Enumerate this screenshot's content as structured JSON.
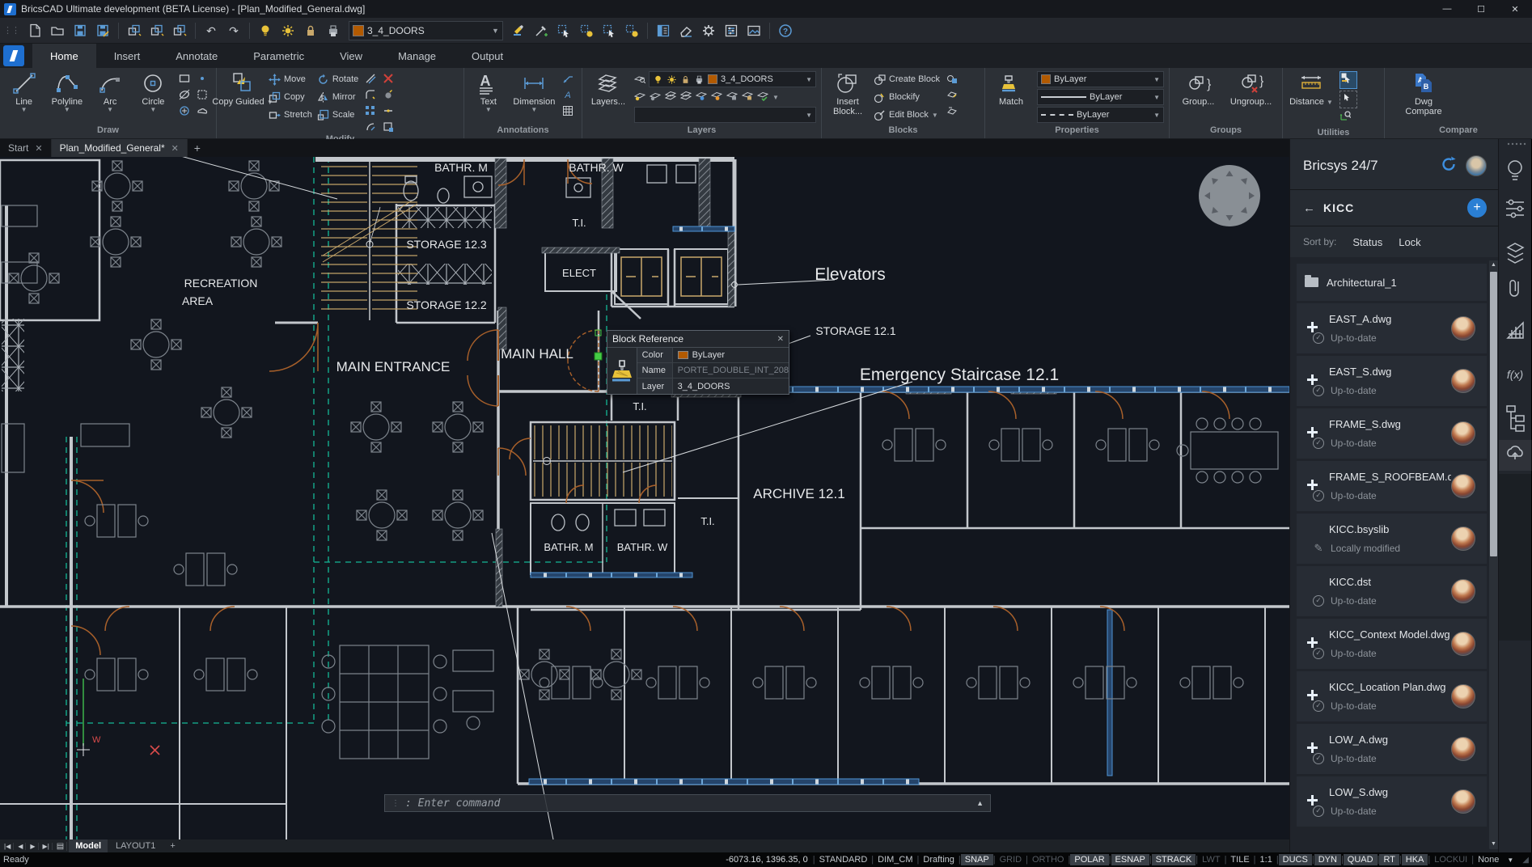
{
  "title_bar": {
    "app_title": "BricsCAD Ultimate development (BETA License) - [Plan_Modified_General.dwg]"
  },
  "quick_access": {
    "layer_selector": "3_4_DOORS"
  },
  "ribbon_tabs": [
    {
      "label": "Home"
    },
    {
      "label": "Insert"
    },
    {
      "label": "Annotate"
    },
    {
      "label": "Parametric"
    },
    {
      "label": "View"
    },
    {
      "label": "Manage"
    },
    {
      "label": "Output"
    }
  ],
  "ribbon": {
    "draw": {
      "label": "Draw",
      "line": "Line",
      "polyline": "Polyline",
      "arc": "Arc",
      "circle": "Circle"
    },
    "modify": {
      "label": "Modify",
      "big1": "Copy",
      "big2": "Guided",
      "move": "Move",
      "copy": "Copy",
      "stretch": "Stretch",
      "rotate": "Rotate",
      "mirror": "Mirror",
      "scale": "Scale"
    },
    "annotations": {
      "label": "Annotations",
      "text": "Text",
      "dimension": "Dimension"
    },
    "layers": {
      "label": "Layers",
      "big": "Layers...",
      "value": "3_4_DOORS"
    },
    "blocks": {
      "label": "Blocks",
      "big1": "Insert",
      "big2": "Block...",
      "create": "Create Block",
      "blockify": "Blockify",
      "edit": "Edit Block"
    },
    "properties": {
      "label": "Properties",
      "match": "Match",
      "color": "ByLayer",
      "lineweight": "ByLayer",
      "linetype": "ByLayer"
    },
    "groups": {
      "label": "Groups",
      "group": "Group...",
      "ungroup": "Ungroup..."
    },
    "utilities": {
      "label": "Utilities",
      "distance": "Distance"
    },
    "compare": {
      "label": "Compare",
      "line1": "Dwg",
      "line2": "Compare"
    }
  },
  "document_tabs": {
    "start": "Start",
    "active": "Plan_Modified_General*"
  },
  "canvas": {
    "labels": [
      {
        "text": "BATHR. M"
      },
      {
        "text": "BATHR. W"
      },
      {
        "text": "T.I."
      },
      {
        "text": "STORAGE 12.3"
      },
      {
        "text": "ELECT"
      },
      {
        "text": "STORAGE 12.2"
      },
      {
        "text": "RECREATION"
      },
      {
        "text": "AREA"
      },
      {
        "text": "MAIN ENTRANCE"
      },
      {
        "text": "MAIN HALL"
      },
      {
        "text": "Elevators"
      },
      {
        "text": "STORAGE 12.1"
      },
      {
        "text": "Emergency Staircase 12.1"
      },
      {
        "text": "T.I."
      },
      {
        "text": "ARCHIVE 12.1"
      },
      {
        "text": "T.I."
      },
      {
        "text": "BATHR. M"
      },
      {
        "text": "BATHR. W"
      }
    ],
    "tooltip": {
      "title": "Block Reference",
      "color_label": "Color",
      "color_value": "ByLayer",
      "name_label": "Name",
      "name_value": "PORTE_DOUBLE_INT_208",
      "layer_label": "Layer",
      "layer_value": "3_4_DOORS",
      "swatch_color": "#b25a00"
    },
    "command": {
      "prompt": ":  Enter command"
    }
  },
  "panel": {
    "title": "Bricsys 24/7",
    "project": "KICC",
    "sort_label": "Sort by:",
    "sort_status": "Status",
    "sort_lock": "Lock",
    "folder": "Architectural_1",
    "files": [
      {
        "name": "EAST_A.dwg",
        "status": "Up-to-date"
      },
      {
        "name": "EAST_S.dwg",
        "status": "Up-to-date"
      },
      {
        "name": "FRAME_S.dwg",
        "status": "Up-to-date"
      },
      {
        "name": "FRAME_S_ROOFBEAM.dwg",
        "status": "Up-to-date"
      },
      {
        "name": "KICC.bsyslib",
        "status": "Locally modified"
      },
      {
        "name": "KICC.dst",
        "status": "Up-to-date"
      },
      {
        "name": "KICC_Context Model.dwg",
        "status": "Up-to-date"
      },
      {
        "name": "KICC_Location Plan.dwg",
        "status": "Up-to-date"
      },
      {
        "name": "LOW_A.dwg",
        "status": "Up-to-date"
      },
      {
        "name": "LOW_S.dwg",
        "status": "Up-to-date"
      }
    ]
  },
  "layout_tabs": {
    "model": "Model",
    "layout1": "LAYOUT1"
  },
  "status_bar": {
    "ready": "Ready",
    "coords": "-6073.16, 1396.35, 0",
    "fields": [
      {
        "label": "STANDARD",
        "state": "normal"
      },
      {
        "label": "DIM_CM",
        "state": "normal"
      },
      {
        "label": "Drafting",
        "state": "normal"
      },
      {
        "label": "SNAP",
        "state": "active"
      },
      {
        "label": "GRID",
        "state": "off"
      },
      {
        "label": "ORTHO",
        "state": "off"
      },
      {
        "label": "POLAR",
        "state": "active"
      },
      {
        "label": "ESNAP",
        "state": "active"
      },
      {
        "label": "STRACK",
        "state": "active"
      },
      {
        "label": "LWT",
        "state": "off"
      },
      {
        "label": "TILE",
        "state": "normal"
      },
      {
        "label": "1:1",
        "state": "normal"
      },
      {
        "label": "DUCS",
        "state": "active"
      },
      {
        "label": "DYN",
        "state": "active"
      },
      {
        "label": "QUAD",
        "state": "active"
      },
      {
        "label": "RT",
        "state": "active"
      },
      {
        "label": "HKA",
        "state": "active"
      },
      {
        "label": "LOCKUI",
        "state": "off"
      },
      {
        "label": "None",
        "state": "normal"
      }
    ]
  }
}
